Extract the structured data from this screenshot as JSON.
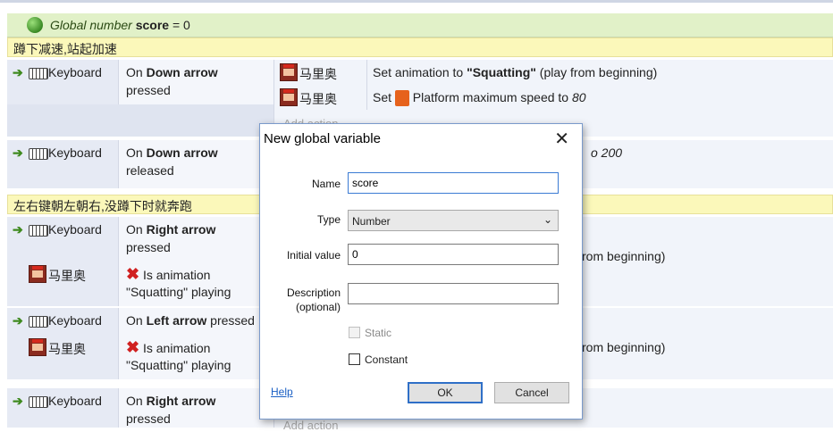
{
  "global_var": {
    "prefix": "Global number",
    "name": "score",
    "suffix": "= 0"
  },
  "comments": {
    "c1": "蹲下减速,站起加速",
    "c2": "左右键朝左朝右,没蹲下时就奔跑"
  },
  "labels": {
    "keyboard": "Keyboard",
    "object": "马里奥",
    "on": "On",
    "down_arrow": "Down arrow",
    "right_arrow": "Right arrow",
    "left_arrow": "Left arrow",
    "pressed": "pressed",
    "released": "released",
    "is_animation": "Is animation",
    "squatting_playing": "\"Squatting\" playing",
    "add_action": "Add action"
  },
  "actions": {
    "a1_pre": "Set animation to",
    "a1_val": "\"Squatting\"",
    "a1_post": "(play from beginning)",
    "a2_pre": "Set",
    "a2_mid": "Platform maximum speed to",
    "a2_val": "80",
    "a3_tail": "o 200",
    "a4_tail": "rom beginning)",
    "a5_tail": "rom beginning)"
  },
  "dialog": {
    "title": "New global variable",
    "name_label": "Name",
    "name_value": "score",
    "type_label": "Type",
    "type_value": "Number",
    "initial_label": "Initial value",
    "initial_value": "0",
    "desc_label": "Description",
    "desc_label2": "(optional)",
    "desc_value": "",
    "static_label": "Static",
    "constant_label": "Constant",
    "help_label": "Help",
    "ok_label": "OK",
    "cancel_label": "Cancel"
  }
}
